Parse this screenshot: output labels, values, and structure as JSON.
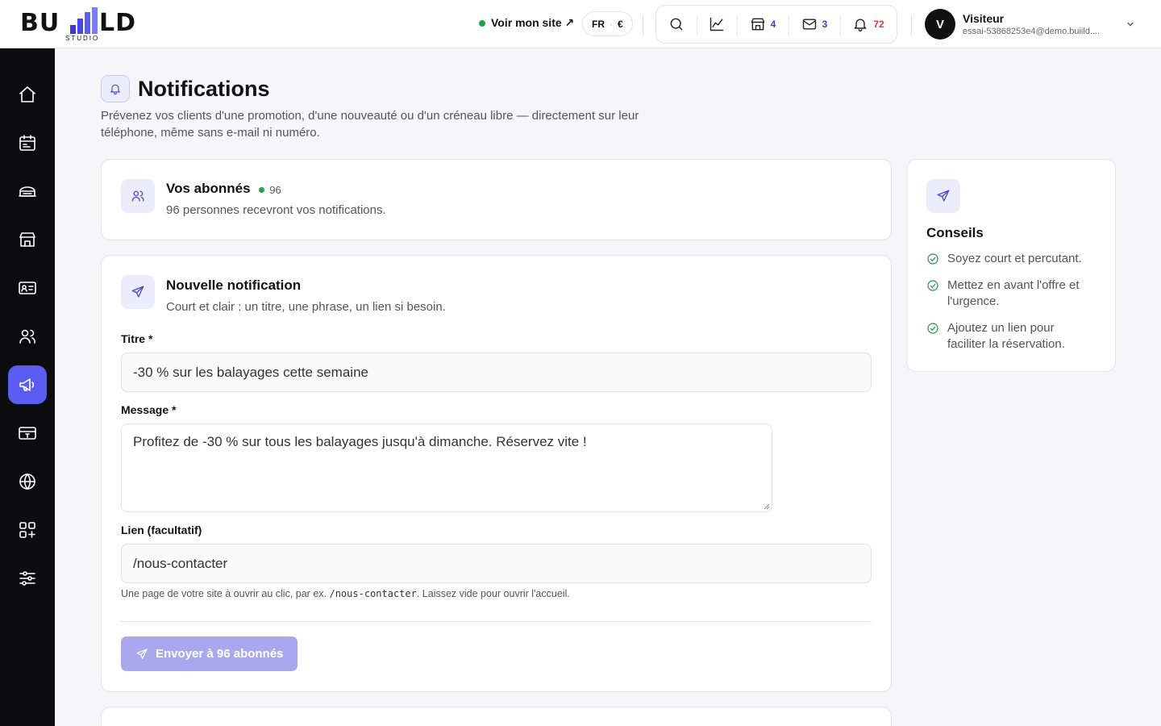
{
  "brand": {
    "logo_word": "BU LD",
    "logo_sub": "STUDIO"
  },
  "header": {
    "site_link": "Voir mon site ↗",
    "lang": "FR",
    "lang_sep": "·",
    "currency": "€",
    "tools": [
      {
        "icon": "search-icon"
      },
      {
        "icon": "analytics-icon"
      },
      {
        "icon": "store-icon",
        "count": "4"
      },
      {
        "icon": "mail-icon",
        "count": "3"
      },
      {
        "icon": "bell-icon",
        "count": "72"
      }
    ],
    "user": {
      "initial": "V",
      "name": "Visiteur",
      "email": "essai-53868253e4@demo.buiild...."
    }
  },
  "sidebar": {
    "items": [
      {
        "icon": "home-icon"
      },
      {
        "icon": "calendar-icon"
      },
      {
        "icon": "services-icon"
      },
      {
        "icon": "store-icon"
      },
      {
        "icon": "contact-card-icon"
      },
      {
        "icon": "users-icon"
      },
      {
        "icon": "megaphone-icon",
        "active": true
      },
      {
        "icon": "payment-icon"
      },
      {
        "icon": "globe-icon"
      },
      {
        "icon": "apps-icon"
      },
      {
        "icon": "settings-sliders-icon"
      }
    ]
  },
  "page": {
    "title": "Notifications",
    "description": "Prévenez vos clients d'une promotion, d'une nouveauté ou d'un créneau libre — directement sur leur téléphone, même sans e-mail ni numéro."
  },
  "subscribers": {
    "title": "Vos abonnés",
    "count": "96",
    "subtitle": "96 personnes recevront vos notifications."
  },
  "form": {
    "title": "Nouvelle notification",
    "subtitle": "Court et clair : un titre, une phrase, un lien si besoin.",
    "title_label": "Titre *",
    "title_value": "-30 % sur les balayages cette semaine",
    "message_label": "Message *",
    "message_value": "Profitez de -30 % sur tous les balayages jusqu'à dimanche. Réservez vite !",
    "link_label": "Lien (facultatif)",
    "link_value": "/nous-contacter",
    "help_before": "Une page de votre site à ouvrir au clic, par ex. ",
    "help_code": "/nous-contacter",
    "help_after": ". Laissez vide pour ouvrir l'accueil.",
    "submit_label": "Envoyer à 96 abonnés"
  },
  "conseils": {
    "title": "Conseils",
    "tips": [
      "Soyez court et percutant.",
      "Mettez en avant l'offre et l'urgence.",
      "Ajoutez un lien pour faciliter la réservation."
    ]
  },
  "colors": {
    "accent": "#5b5cf0",
    "accent_soft": "#ececfd",
    "success": "#20954a",
    "alert": "#d93b3b",
    "sidebar_bg": "#0c0c0e"
  }
}
